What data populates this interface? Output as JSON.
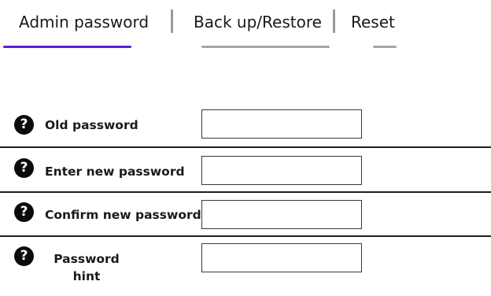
{
  "tabs": [
    {
      "label": "Admin password",
      "active": true
    },
    {
      "label": "Back up/Restore",
      "active": false
    },
    {
      "label": "Reset",
      "active": false
    }
  ],
  "colors": {
    "active_tab_underline": "#5a1ed6",
    "inactive_tab_underline": "#a6a6a6",
    "help_icon": "#0b0b0b"
  },
  "form": {
    "fields": [
      {
        "label": "Old password",
        "value": "",
        "help_icon": "question-circle-icon"
      },
      {
        "label": "Enter new password",
        "value": "",
        "help_icon": "question-circle-icon"
      },
      {
        "label": "Confirm new password",
        "value": "",
        "help_icon": "question-circle-icon"
      },
      {
        "label_line1": "Password",
        "label_line2": "hint",
        "value": "",
        "help_icon": "question-circle-icon"
      }
    ],
    "help_glyph": "?"
  }
}
